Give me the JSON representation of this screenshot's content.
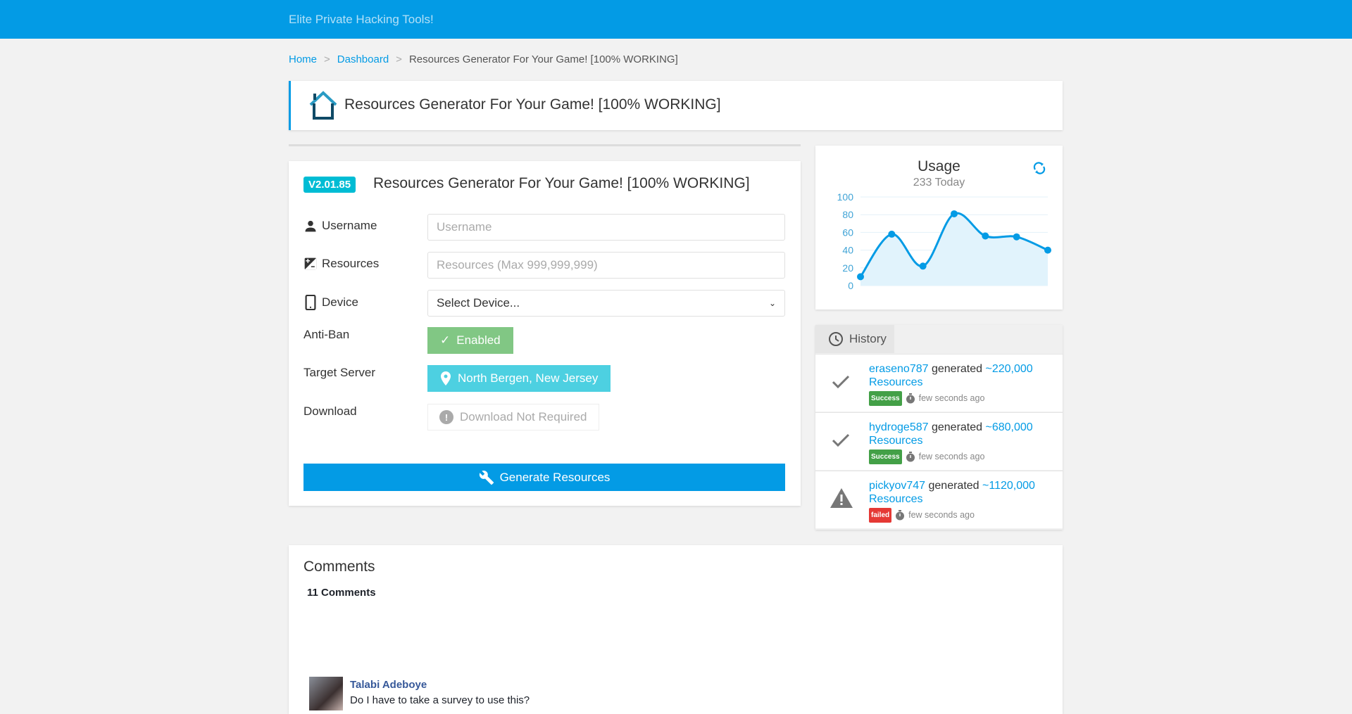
{
  "header": {
    "brand": "Elite Private Hacking Tools!"
  },
  "breadcrumb": {
    "home": "Home",
    "dashboard": "Dashboard",
    "current": "Resources Generator For Your Game! [100% WORKING]"
  },
  "title_card": {
    "title": "Resources Generator For Your Game! [100% WORKING]",
    "icon": "house-icon"
  },
  "form": {
    "version": "V2.01.85",
    "title": "Resources Generator For Your Game! [100% WORKING]",
    "username": {
      "label": "Username",
      "placeholder": "Username"
    },
    "resources": {
      "label": "Resources",
      "placeholder": "Resources (Max 999,999,999)"
    },
    "device": {
      "label": "Device",
      "selected": "Select Device..."
    },
    "antiban": {
      "label": "Anti-Ban",
      "value": "Enabled",
      "color": "#81c784"
    },
    "server": {
      "label": "Target Server",
      "value": "North Bergen, New Jersey",
      "color": "#4dd0e1"
    },
    "download": {
      "label": "Download",
      "value": "Download Not Required"
    },
    "generate": "Generate Resources",
    "accent": "#039be5"
  },
  "usage": {
    "title": "Usage",
    "subtitle": "233 Today"
  },
  "chart_data": {
    "type": "line",
    "title": "Usage",
    "smooth": true,
    "filled": true,
    "x": [
      1,
      2,
      3,
      4,
      5,
      6,
      7
    ],
    "values": [
      10,
      58,
      22,
      81,
      56,
      55,
      40
    ],
    "ylim": [
      0,
      100
    ],
    "yticks": [
      "0",
      "20",
      "40",
      "60",
      "80",
      "100"
    ],
    "grid": true,
    "color": "#039be5"
  },
  "history": {
    "tab": "History",
    "items": [
      {
        "user": "eraseno787",
        "verb": "generated",
        "amount": "~220,000",
        "unit": "Resources",
        "status": "Success",
        "time": "few seconds ago",
        "icon": "check-icon"
      },
      {
        "user": "hydroge587",
        "verb": "generated",
        "amount": "~680,000",
        "unit": "Resources",
        "status": "Success",
        "time": "few seconds ago",
        "icon": "check-icon"
      },
      {
        "user": "pickyov747",
        "verb": "generated",
        "amount": "~1120,000",
        "unit": "Resources",
        "status": "failed",
        "time": "few seconds ago",
        "icon": "warning-icon"
      }
    ]
  },
  "comments": {
    "title": "Comments",
    "count": "11 Comments",
    "items": [
      {
        "name": "Talabi Adeboye",
        "text": "Do I have to take a survey to use this?"
      }
    ]
  }
}
